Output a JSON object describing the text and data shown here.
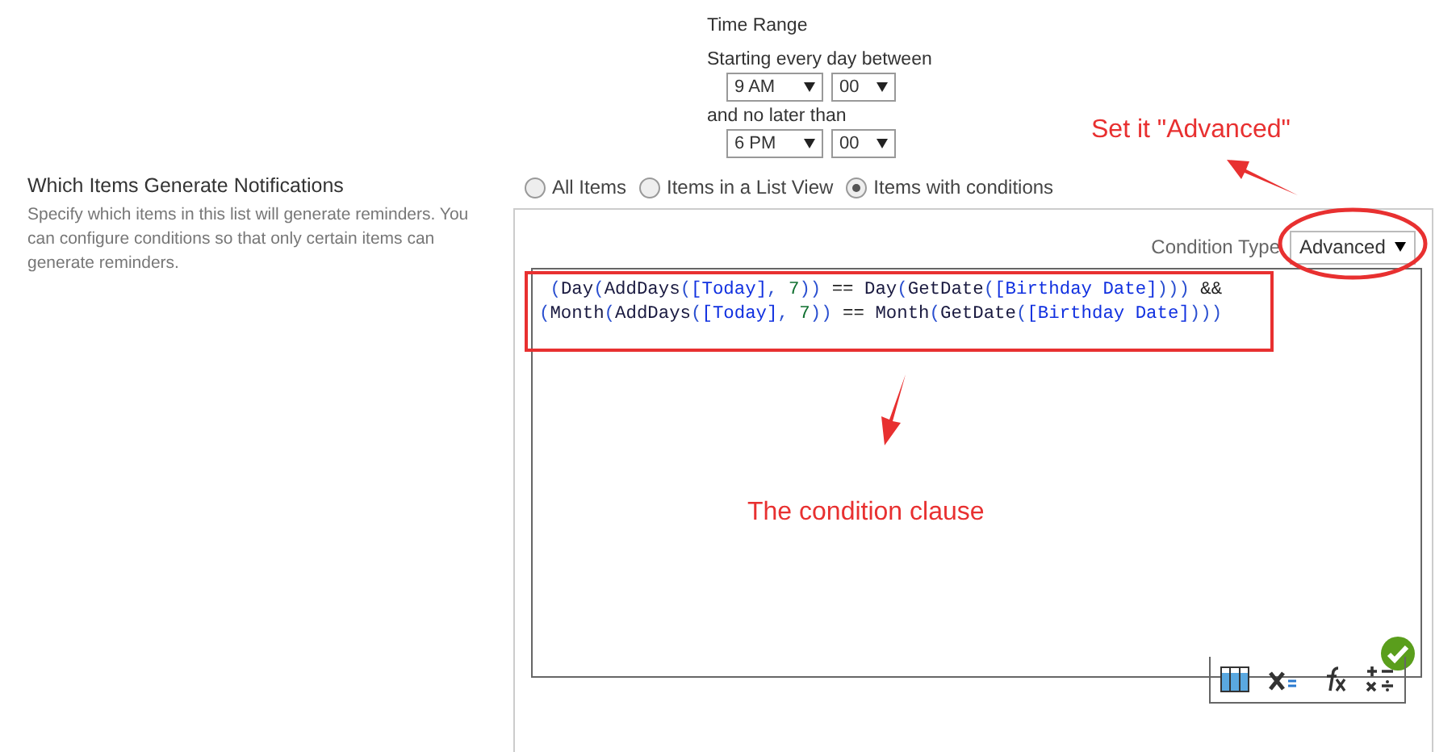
{
  "time_range": {
    "title": "Time Range",
    "start_label": "Starting every day between",
    "start_hour": "9 AM",
    "start_minute": "00",
    "end_label": "and no later than",
    "end_hour": "6 PM",
    "end_minute": "00"
  },
  "section": {
    "title": "Which Items Generate Notifications",
    "description": "Specify which items in this list will generate reminders. You can configure conditions so that only certain items can generate reminders."
  },
  "item_options": [
    {
      "label": "All Items",
      "selected": false
    },
    {
      "label": "Items in a List View",
      "selected": false
    },
    {
      "label": "Items with conditions",
      "selected": true
    }
  ],
  "condition_type": {
    "label": "Condition Type",
    "value": "Advanced"
  },
  "code_lines": [
    [
      {
        "kind": "punct",
        "text": " ("
      },
      {
        "kind": "func",
        "text": "Day"
      },
      {
        "kind": "punct",
        "text": "("
      },
      {
        "kind": "func",
        "text": "AddDays"
      },
      {
        "kind": "punct",
        "text": "("
      },
      {
        "kind": "field",
        "text": "[Today]"
      },
      {
        "kind": "punct",
        "text": ", "
      },
      {
        "kind": "number",
        "text": "7"
      },
      {
        "kind": "punct",
        "text": "))"
      },
      {
        "kind": "op",
        "text": " == "
      },
      {
        "kind": "func",
        "text": "Day"
      },
      {
        "kind": "punct",
        "text": "("
      },
      {
        "kind": "func",
        "text": "GetDate"
      },
      {
        "kind": "punct",
        "text": "("
      },
      {
        "kind": "field",
        "text": "[Birthday Date]"
      },
      {
        "kind": "punct",
        "text": ")))"
      },
      {
        "kind": "op",
        "text": " &&"
      }
    ],
    [
      {
        "kind": "punct",
        "text": "("
      },
      {
        "kind": "func",
        "text": "Month"
      },
      {
        "kind": "punct",
        "text": "("
      },
      {
        "kind": "func",
        "text": "AddDays"
      },
      {
        "kind": "punct",
        "text": "("
      },
      {
        "kind": "field",
        "text": "[Today]"
      },
      {
        "kind": "punct",
        "text": ", "
      },
      {
        "kind": "number",
        "text": "7"
      },
      {
        "kind": "punct",
        "text": "))"
      },
      {
        "kind": "op",
        "text": " == "
      },
      {
        "kind": "func",
        "text": "Month"
      },
      {
        "kind": "punct",
        "text": "("
      },
      {
        "kind": "func",
        "text": "GetDate"
      },
      {
        "kind": "punct",
        "text": "("
      },
      {
        "kind": "field",
        "text": "[Birthday Date]"
      },
      {
        "kind": "punct",
        "text": ")))"
      }
    ]
  ],
  "annotations": [
    {
      "text": "Set it \"Advanced\""
    },
    {
      "text": "The condition clause"
    }
  ]
}
